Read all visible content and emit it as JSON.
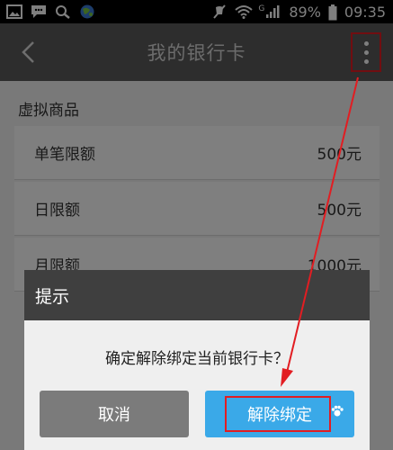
{
  "status_bar": {
    "network_badge": "G",
    "battery_percent": "89%",
    "time": "09:35",
    "icons": [
      "gallery-icon",
      "message-icon",
      "search-icon",
      "browser-globe-icon",
      "mute-icon",
      "wifi-icon",
      "signal-icon",
      "battery-icon"
    ]
  },
  "app_bar": {
    "title": "我的银行卡",
    "back_icon": "chevron-left-icon",
    "more_icon": "more-vertical-icon"
  },
  "section": {
    "title": "虚拟商品",
    "rows": [
      {
        "label": "单笔限额",
        "value": "500元"
      },
      {
        "label": "日限额",
        "value": "500元"
      },
      {
        "label": "月限额",
        "value": "1000元"
      }
    ]
  },
  "dialog": {
    "title": "提示",
    "message": "确定解除绑定当前银行卡？",
    "cancel_label": "取消",
    "confirm_label": "解除绑定"
  },
  "colors": {
    "app_bar": "#5a5a5a",
    "dialog_header": "#3f3f3f",
    "confirm_button": "#3aa9e8",
    "cancel_button": "#7b7b7b",
    "annotation": "#e21d22"
  }
}
